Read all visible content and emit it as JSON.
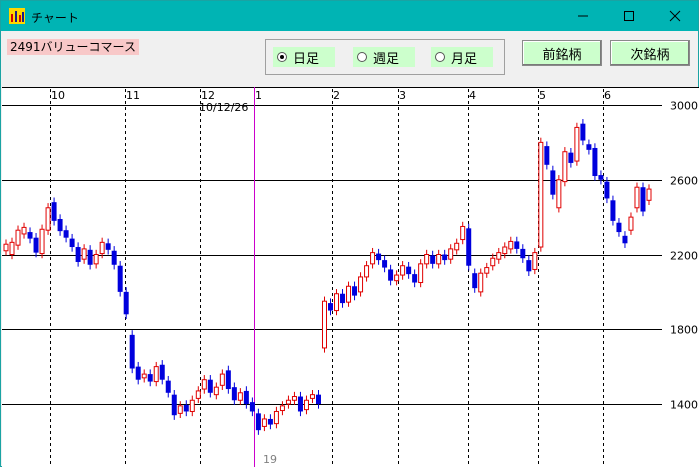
{
  "window": {
    "title": "チャート",
    "controls": [
      "minimize-icon",
      "maximize-icon",
      "close-icon"
    ]
  },
  "stock": {
    "label": "2491バリューコマース"
  },
  "period": {
    "options": [
      {
        "label": "日足",
        "selected": true
      },
      {
        "label": "週足",
        "selected": false
      },
      {
        "label": "月足",
        "selected": false
      }
    ]
  },
  "buttons": {
    "prev": "前銘柄",
    "next": "次銘柄"
  },
  "colors": {
    "titlebar": "#00b4b4",
    "up": "#e00000",
    "down": "#0000dd",
    "option_bg": "#ccffcc",
    "label_bg": "#f8c8c8"
  },
  "chart_data": {
    "type": "candlestick",
    "y_ticks": [
      3000,
      2600,
      2200,
      1800,
      1400
    ],
    "ylim": [
      1200,
      3000
    ],
    "month_labels": [
      "10",
      "11",
      "12",
      "1",
      "2",
      "3",
      "4",
      "5",
      "6"
    ],
    "cursor_date": "10/12/26",
    "cursor_day": "19",
    "grid": true,
    "points": [
      [
        2220,
        2255
      ],
      [
        2200,
        2265
      ],
      [
        2250,
        2330
      ],
      [
        2310,
        2345
      ],
      [
        2320,
        2285
      ],
      [
        2290,
        2210
      ],
      [
        2205,
        2335
      ],
      [
        2330,
        2450
      ],
      [
        2480,
        2380
      ],
      [
        2390,
        2325
      ],
      [
        2330,
        2290
      ],
      [
        2285,
        2240
      ],
      [
        2240,
        2160
      ],
      [
        2175,
        2230
      ],
      [
        2225,
        2145
      ],
      [
        2150,
        2200
      ],
      [
        2205,
        2265
      ],
      [
        2260,
        2225
      ],
      [
        2220,
        2145
      ],
      [
        2140,
        2000
      ],
      [
        2000,
        1880
      ],
      [
        1770,
        1590
      ],
      [
        1600,
        1530
      ],
      [
        1540,
        1560
      ],
      [
        1560,
        1520
      ],
      [
        1520,
        1600
      ],
      [
        1610,
        1530
      ],
      [
        1525,
        1460
      ],
      [
        1450,
        1340
      ],
      [
        1350,
        1390
      ],
      [
        1395,
        1360
      ],
      [
        1360,
        1420
      ],
      [
        1430,
        1470
      ],
      [
        1480,
        1530
      ],
      [
        1530,
        1460
      ],
      [
        1450,
        1490
      ],
      [
        1500,
        1560
      ],
      [
        1580,
        1480
      ],
      [
        1490,
        1420
      ],
      [
        1420,
        1460
      ],
      [
        1470,
        1400
      ],
      [
        1410,
        1360
      ],
      [
        1350,
        1260
      ],
      [
        1280,
        1320
      ],
      [
        1320,
        1290
      ],
      [
        1295,
        1360
      ],
      [
        1365,
        1390
      ],
      [
        1400,
        1420
      ],
      [
        1420,
        1440
      ],
      [
        1440,
        1360
      ],
      [
        1370,
        1420
      ],
      [
        1430,
        1450
      ],
      [
        1450,
        1400
      ],
      [
        1700,
        1950
      ],
      [
        1940,
        1900
      ],
      [
        1900,
        1990
      ],
      [
        1990,
        1940
      ],
      [
        1945,
        2030
      ],
      [
        2030,
        1980
      ],
      [
        2000,
        2080
      ],
      [
        2080,
        2140
      ],
      [
        2150,
        2210
      ],
      [
        2205,
        2170
      ],
      [
        2170,
        2130
      ],
      [
        2120,
        2060
      ],
      [
        2060,
        2090
      ],
      [
        2090,
        2140
      ],
      [
        2135,
        2095
      ],
      [
        2095,
        2050
      ],
      [
        2050,
        2150
      ],
      [
        2150,
        2200
      ],
      [
        2195,
        2150
      ],
      [
        2150,
        2200
      ],
      [
        2200,
        2170
      ],
      [
        2175,
        2230
      ],
      [
        2225,
        2260
      ],
      [
        2280,
        2350
      ],
      [
        2340,
        2140
      ],
      [
        2100,
        2020
      ],
      [
        2000,
        2100
      ],
      [
        2100,
        2130
      ],
      [
        2140,
        2180
      ],
      [
        2175,
        2210
      ],
      [
        2205,
        2240
      ],
      [
        2230,
        2270
      ],
      [
        2270,
        2230
      ],
      [
        2230,
        2180
      ],
      [
        2170,
        2110
      ],
      [
        2120,
        2210
      ],
      [
        2240,
        2800
      ],
      [
        2780,
        2680
      ],
      [
        2650,
        2520
      ],
      [
        2450,
        2600
      ],
      [
        2590,
        2750
      ],
      [
        2745,
        2690
      ],
      [
        2700,
        2880
      ],
      [
        2900,
        2810
      ],
      [
        2790,
        2760
      ],
      [
        2770,
        2620
      ],
      [
        2625,
        2600
      ],
      [
        2590,
        2500
      ],
      [
        2490,
        2380
      ],
      [
        2370,
        2320
      ],
      [
        2300,
        2260
      ],
      [
        2330,
        2400
      ],
      [
        2450,
        2560
      ],
      [
        2560,
        2430
      ],
      [
        2490,
        2550
      ]
    ]
  }
}
